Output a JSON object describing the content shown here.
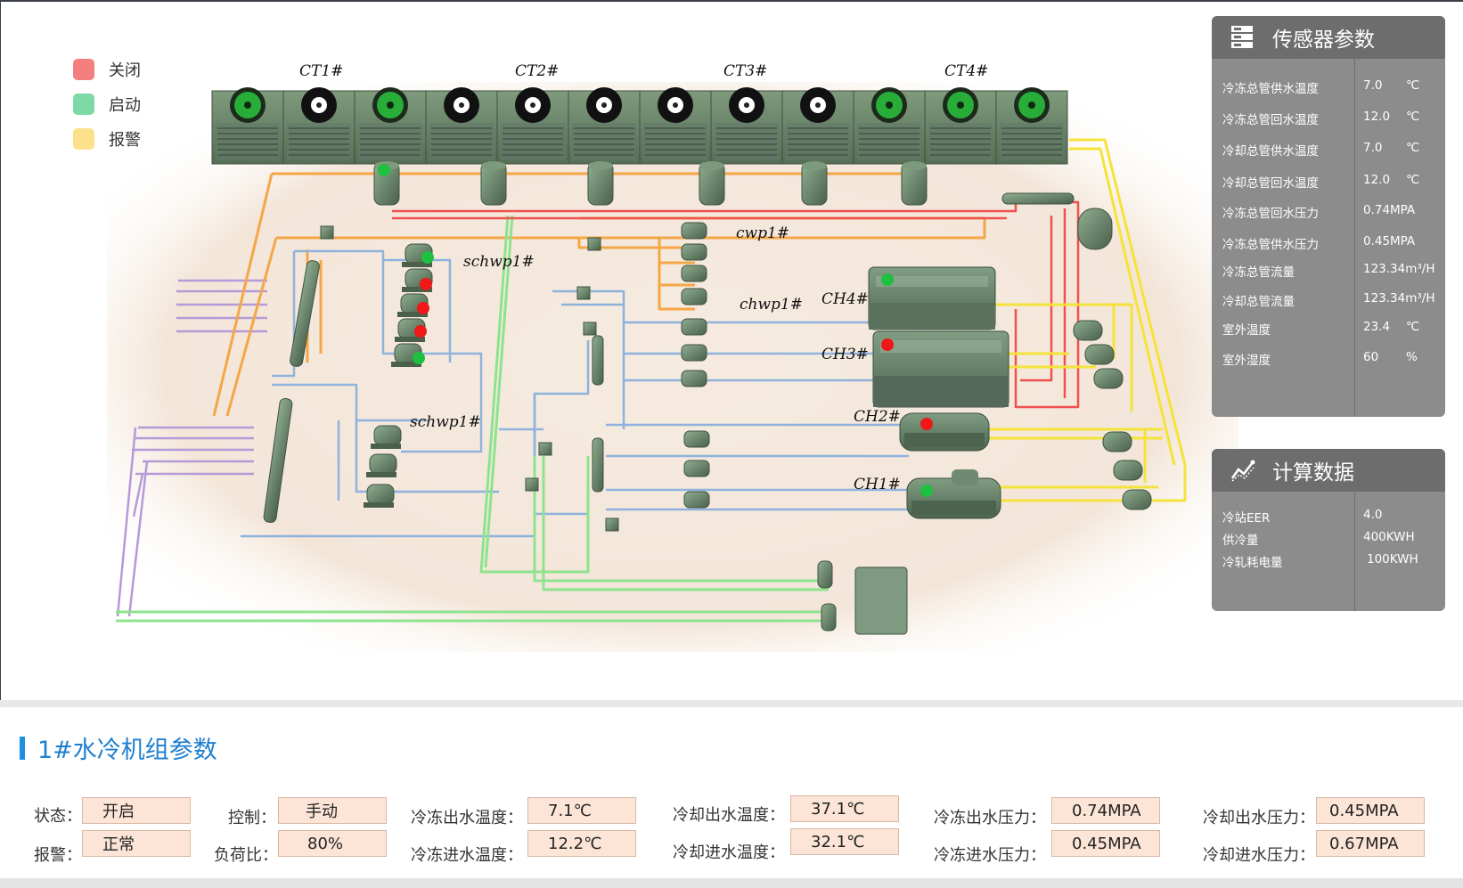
{
  "legend": [
    {
      "label": "关闭",
      "color": "#f47f7f"
    },
    {
      "label": "启动",
      "color": "#7ed9a7"
    },
    {
      "label": "报警",
      "color": "#fce08a"
    }
  ],
  "equipment_labels": {
    "ct1": "CT1#",
    "ct2": "CT2#",
    "ct3": "CT3#",
    "ct4": "CT4#",
    "cwp": "cwp1#",
    "schwp_top": "schwp1#",
    "schwp_bottom": "schwp1#",
    "chwp": "chwp1#",
    "ch4": "CH4#",
    "ch3": "CH3#",
    "ch2": "CH2#",
    "ch1": "CH1#"
  },
  "status_colors": {
    "on": "#1fbf3f",
    "off": "#f01818"
  },
  "sensor_panel": {
    "title": "传感器参数",
    "icon": "server-icon",
    "rows": [
      {
        "name": "冷冻总管供水温度",
        "value": "7.0",
        "unit": "℃"
      },
      {
        "name": "冷冻总管回水温度",
        "value": "12.0",
        "unit": "℃"
      },
      {
        "name": "冷却总管供水温度",
        "value": "7.0",
        "unit": "℃"
      },
      {
        "name": "冷却总管回水温度",
        "value": "12.0",
        "unit": "℃"
      },
      {
        "name": "冷冻总管回水压力",
        "value": "0.74",
        "unit": "MPA"
      },
      {
        "name": "冷冻总管供水压力",
        "value": "0.45",
        "unit": "MPA"
      },
      {
        "name": "冷冻总管流量",
        "value": "123.34m³/H",
        "unit": ""
      },
      {
        "name": "冷却总管流量",
        "value": "123.34m³/H",
        "unit": ""
      },
      {
        "name": "室外温度",
        "value": "23.4",
        "unit": "℃"
      },
      {
        "name": "室外湿度",
        "value": "60",
        "unit": "%"
      }
    ]
  },
  "calc_panel": {
    "title": "计算数据",
    "icon": "chart-line-icon",
    "rows": [
      {
        "name": "冷站EER",
        "value": "4.0"
      },
      {
        "name": "供冷量",
        "value": "400KWH"
      },
      {
        "name": "冷轧耗电量",
        "value": "100KWH"
      }
    ]
  },
  "unit_params": {
    "title": "1#水冷机组参数",
    "fields": [
      {
        "label": "状态：",
        "value": "开启"
      },
      {
        "label": "报警：",
        "value": "正常"
      },
      {
        "label": "控制：",
        "value": "手动"
      },
      {
        "label": "负荷比：",
        "value": "80%"
      },
      {
        "label": "冷冻出水温度：",
        "value": "7.1℃"
      },
      {
        "label": "冷冻进水温度：",
        "value": "12.2℃"
      },
      {
        "label": "冷却出水温度：",
        "value": "37.1℃"
      },
      {
        "label": "冷却进水温度：",
        "value": "32.1℃"
      },
      {
        "label": "冷冻出水压力：",
        "value": "0.74MPA"
      },
      {
        "label": "冷冻进水压力：",
        "value": "0.45MPA"
      },
      {
        "label": "冷却出水压力：",
        "value": "0.45MPA"
      },
      {
        "label": "冷却进水压力：",
        "value": "0.67MPA"
      }
    ]
  }
}
